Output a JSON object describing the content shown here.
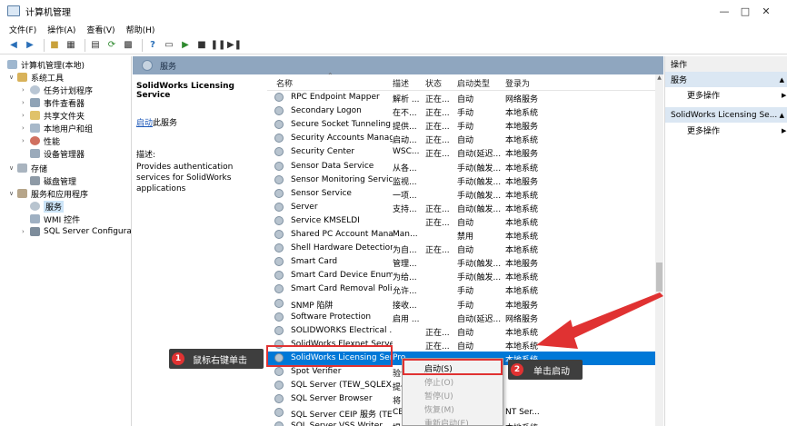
{
  "window": {
    "title": "计算机管理"
  },
  "menu": [
    "文件(F)",
    "操作(A)",
    "查看(V)",
    "帮助(H)"
  ],
  "tree": [
    {
      "label": "计算机管理(本地)",
      "icon": "computer-icon"
    },
    {
      "label": "系统工具",
      "icon": "tools-icon"
    },
    {
      "label": "任务计划程序",
      "icon": "clock-icon"
    },
    {
      "label": "事件查看器",
      "icon": "event-viewer-icon"
    },
    {
      "label": "共享文件夹",
      "icon": "folder-icon"
    },
    {
      "label": "本地用户和组",
      "icon": "users-icon"
    },
    {
      "label": "性能",
      "icon": "performance-icon"
    },
    {
      "label": "设备管理器",
      "icon": "device-icon"
    },
    {
      "label": "存储",
      "icon": "storage-icon"
    },
    {
      "label": "磁盘管理",
      "icon": "disk-icon"
    },
    {
      "label": "服务和应用程序",
      "icon": "services-apps-icon"
    },
    {
      "label": "服务",
      "icon": "services-icon"
    },
    {
      "label": "WMI 控件",
      "icon": "wmi-icon"
    },
    {
      "label": "SQL Server Configura",
      "icon": "sql-icon"
    }
  ],
  "services_header": {
    "title": "服务"
  },
  "description": {
    "name": "SolidWorks Licensing Service",
    "start_link": "启动",
    "start_suffix": "此服务",
    "desc_label": "描述:",
    "desc_text": "Provides authentication services for SolidWorks applications"
  },
  "columns": {
    "name": "名称",
    "desc": "描述",
    "status": "状态",
    "startup": "启动类型",
    "logon": "登录为"
  },
  "services": [
    {
      "name": "RPC Endpoint Mapper",
      "desc": "解析 ...",
      "status": "正在...",
      "startup": "自动",
      "logon": "网络服务"
    },
    {
      "name": "Secondary Logon",
      "desc": "在不...",
      "status": "正在...",
      "startup": "手动",
      "logon": "本地系统"
    },
    {
      "name": "Secure Socket Tunneling ...",
      "desc": "提供...",
      "status": "正在...",
      "startup": "手动",
      "logon": "本地服务"
    },
    {
      "name": "Security Accounts Manag...",
      "desc": "启动...",
      "status": "正在...",
      "startup": "自动",
      "logon": "本地系统"
    },
    {
      "name": "Security Center",
      "desc": "WSC...",
      "status": "正在...",
      "startup": "自动(延迟...",
      "logon": "本地服务"
    },
    {
      "name": "Sensor Data Service",
      "desc": "从各...",
      "status": "",
      "startup": "手动(触发...",
      "logon": "本地系统"
    },
    {
      "name": "Sensor Monitoring Service",
      "desc": "监视...",
      "status": "",
      "startup": "手动(触发...",
      "logon": "本地服务"
    },
    {
      "name": "Sensor Service",
      "desc": "一项...",
      "status": "",
      "startup": "手动(触发...",
      "logon": "本地系统"
    },
    {
      "name": "Server",
      "desc": "支持...",
      "status": "正在...",
      "startup": "自动(触发...",
      "logon": "本地系统"
    },
    {
      "name": "Service KMSELDI",
      "desc": "",
      "status": "正在...",
      "startup": "自动",
      "logon": "本地系统"
    },
    {
      "name": "Shared PC Account Mana...",
      "desc": "Man...",
      "status": "",
      "startup": "禁用",
      "logon": "本地系统"
    },
    {
      "name": "Shell Hardware Detection",
      "desc": "为自...",
      "status": "正在...",
      "startup": "自动",
      "logon": "本地系统"
    },
    {
      "name": "Smart Card",
      "desc": "管理...",
      "status": "",
      "startup": "手动(触发...",
      "logon": "本地服务"
    },
    {
      "name": "Smart Card Device Enum...",
      "desc": "为给...",
      "status": "",
      "startup": "手动(触发...",
      "logon": "本地系统"
    },
    {
      "name": "Smart Card Removal Poli...",
      "desc": "允许...",
      "status": "",
      "startup": "手动",
      "logon": "本地系统"
    },
    {
      "name": "SNMP 陷阱",
      "desc": "接收...",
      "status": "",
      "startup": "手动",
      "logon": "本地服务"
    },
    {
      "name": "Software Protection",
      "desc": "启用 ...",
      "status": "",
      "startup": "自动(延迟...",
      "logon": "网络服务"
    },
    {
      "name": "SOLIDWORKS Electrical ...",
      "desc": "",
      "status": "正在...",
      "startup": "自动",
      "logon": "本地系统"
    },
    {
      "name": "SolidWorks Flexnet Server",
      "desc": "",
      "status": "正在...",
      "startup": "自动",
      "logon": "本地系统"
    },
    {
      "name": "SolidWorks Licensing Ser...",
      "desc": "Pro...",
      "status": "",
      "startup": "",
      "logon": "本地系统"
    },
    {
      "name": "Spot Verifier",
      "desc": "验证...",
      "status": "",
      "startup": "",
      "logon": ""
    },
    {
      "name": "SQL Server (TEW_SQLEX...",
      "desc": "提供...",
      "status": "",
      "startup": "",
      "logon": ""
    },
    {
      "name": "SQL Server Browser",
      "desc": "将 ...",
      "status": "",
      "startup": "",
      "logon": ""
    },
    {
      "name": "SQL Server CEIP 服务 (TE...",
      "desc": "CEI...",
      "status": "",
      "startup": "",
      "logon": "NT Ser..."
    },
    {
      "name": "SQL Server VSS Writer",
      "desc": "提供...",
      "status": "",
      "startup": "",
      "logon": "本地系统"
    }
  ],
  "selected_index": 19,
  "actions": {
    "header": "操作",
    "sec1": "服务",
    "sec1_more": "更多操作",
    "sec2": "SolidWorks Licensing Se...",
    "sec2_more": "更多操作"
  },
  "context_menu": [
    {
      "label": "启动(S)",
      "enabled": true
    },
    {
      "label": "停止(O)",
      "enabled": false
    },
    {
      "label": "暂停(U)",
      "enabled": false
    },
    {
      "label": "恢复(M)",
      "enabled": false
    },
    {
      "label": "重新启动(E)",
      "enabled": false
    }
  ],
  "annotations": {
    "step1_num": "1",
    "step1_text": "鼠标右键单击",
    "step2_num": "2",
    "step2_text": "单击启动"
  },
  "colors": {
    "selection": "#0078d7",
    "annotation": "#e03232",
    "header": "#8fa6bf"
  }
}
